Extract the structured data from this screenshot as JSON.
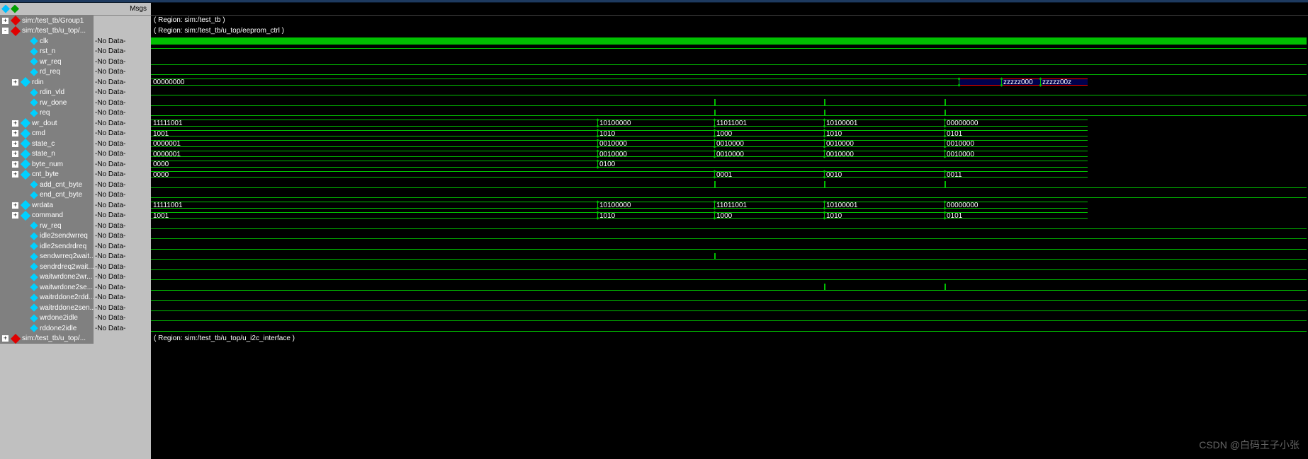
{
  "header": {
    "msgs_label": "Msgs"
  },
  "regions": {
    "r1": "( Region: sim:/test_tb )",
    "r2": "( Region: sim:/test_tb/u_top/eeprom_ctrl )",
    "r3": "( Region: sim:/test_tb/u_top/u_i2c_interface )"
  },
  "no_data": "-No Data-",
  "signals": [
    {
      "name": "sim:/test_tb/Group1",
      "type": "group",
      "exp": "+",
      "val": ""
    },
    {
      "name": "sim:/test_tb/u_top/...",
      "type": "group",
      "exp": "-",
      "val": ""
    },
    {
      "name": "clk",
      "type": "leaf",
      "indent": 3,
      "val": "-No Data-"
    },
    {
      "name": "rst_n",
      "type": "leaf",
      "indent": 3,
      "val": "-No Data-"
    },
    {
      "name": "wr_req",
      "type": "leaf",
      "indent": 3,
      "val": "-No Data-"
    },
    {
      "name": "rd_req",
      "type": "leaf",
      "indent": 3,
      "val": "-No Data-"
    },
    {
      "name": "rdin",
      "type": "bus",
      "exp": "+",
      "indent": 2,
      "val": "-No Data-"
    },
    {
      "name": "rdin_vld",
      "type": "leaf",
      "indent": 3,
      "val": "-No Data-"
    },
    {
      "name": "rw_done",
      "type": "leaf",
      "indent": 3,
      "val": "-No Data-"
    },
    {
      "name": "req",
      "type": "leaf",
      "indent": 3,
      "val": "-No Data-"
    },
    {
      "name": "wr_dout",
      "type": "bus",
      "exp": "+",
      "indent": 2,
      "val": "-No Data-"
    },
    {
      "name": "cmd",
      "type": "bus",
      "exp": "+",
      "indent": 2,
      "val": "-No Data-"
    },
    {
      "name": "state_c",
      "type": "bus",
      "exp": "+",
      "indent": 2,
      "val": "-No Data-"
    },
    {
      "name": "state_n",
      "type": "bus",
      "exp": "+",
      "indent": 2,
      "val": "-No Data-"
    },
    {
      "name": "byte_num",
      "type": "bus",
      "exp": "+",
      "indent": 2,
      "val": "-No Data-"
    },
    {
      "name": "cnt_byte",
      "type": "bus",
      "exp": "+",
      "indent": 2,
      "val": "-No Data-"
    },
    {
      "name": "add_cnt_byte",
      "type": "leaf",
      "indent": 3,
      "val": "-No Data-"
    },
    {
      "name": "end_cnt_byte",
      "type": "leaf",
      "indent": 3,
      "val": "-No Data-"
    },
    {
      "name": "wrdata",
      "type": "bus",
      "exp": "+",
      "indent": 2,
      "val": "-No Data-"
    },
    {
      "name": "command",
      "type": "bus",
      "exp": "+",
      "indent": 2,
      "val": "-No Data-"
    },
    {
      "name": "rw_req",
      "type": "leaf",
      "indent": 3,
      "val": "-No Data-"
    },
    {
      "name": "idle2sendwrreq",
      "type": "leaf",
      "indent": 3,
      "val": "-No Data-"
    },
    {
      "name": "idle2sendrdreq",
      "type": "leaf",
      "indent": 3,
      "val": "-No Data-"
    },
    {
      "name": "sendwrreq2wait...",
      "type": "leaf",
      "indent": 3,
      "val": "-No Data-"
    },
    {
      "name": "sendrdreq2wait...",
      "type": "leaf",
      "indent": 3,
      "val": "-No Data-"
    },
    {
      "name": "waitwrdone2wr...",
      "type": "leaf",
      "indent": 3,
      "val": "-No Data-"
    },
    {
      "name": "waitwrdone2se...",
      "type": "leaf",
      "indent": 3,
      "val": "-No Data-"
    },
    {
      "name": "waitrddone2rdd...",
      "type": "leaf",
      "indent": 3,
      "val": "-No Data-"
    },
    {
      "name": "waitrddone2sen...",
      "type": "leaf",
      "indent": 3,
      "val": "-No Data-"
    },
    {
      "name": "wrdone2idle",
      "type": "leaf",
      "indent": 3,
      "val": "-No Data-"
    },
    {
      "name": "rddone2idle",
      "type": "leaf",
      "indent": 3,
      "val": "-No Data-"
    },
    {
      "name": "sim:/test_tb/u_top/...",
      "type": "group",
      "exp": "+",
      "val": ""
    }
  ],
  "bus_data": {
    "rdin": {
      "segments": [
        {
          "start": 0,
          "end": 1140,
          "label": "00000000"
        },
        {
          "start": 1140,
          "end": 1200,
          "label": "",
          "z": true
        },
        {
          "start": 1200,
          "end": 1255,
          "label": "zzzzz000",
          "z": true
        },
        {
          "start": 1255,
          "end": 1322,
          "label": "zzzzz00z",
          "z": true
        }
      ]
    },
    "wr_dout": {
      "segments": [
        {
          "start": 0,
          "end": 630,
          "label": "11111001"
        },
        {
          "start": 630,
          "end": 795,
          "label": "10100000"
        },
        {
          "start": 795,
          "end": 950,
          "label": "11011001"
        },
        {
          "start": 950,
          "end": 1120,
          "label": "10100001"
        },
        {
          "start": 1120,
          "end": 1322,
          "label": "00000000"
        }
      ]
    },
    "cmd": {
      "segments": [
        {
          "start": 0,
          "end": 630,
          "label": "1001"
        },
        {
          "start": 630,
          "end": 795,
          "label": "1010"
        },
        {
          "start": 795,
          "end": 950,
          "label": "1000"
        },
        {
          "start": 950,
          "end": 1120,
          "label": "1010"
        },
        {
          "start": 1120,
          "end": 1322,
          "label": "0101"
        }
      ]
    },
    "state_c": {
      "segments": [
        {
          "start": 0,
          "end": 630,
          "label": "0000001"
        },
        {
          "start": 630,
          "end": 795,
          "label": "0010000"
        },
        {
          "start": 795,
          "end": 950,
          "label": "0010000"
        },
        {
          "start": 950,
          "end": 1120,
          "label": "0010000"
        },
        {
          "start": 1120,
          "end": 1322,
          "label": "0010000"
        }
      ]
    },
    "state_n": {
      "segments": [
        {
          "start": 0,
          "end": 630,
          "label": "0000001"
        },
        {
          "start": 630,
          "end": 795,
          "label": "0010000"
        },
        {
          "start": 795,
          "end": 950,
          "label": "0010000"
        },
        {
          "start": 950,
          "end": 1120,
          "label": "0010000"
        },
        {
          "start": 1120,
          "end": 1322,
          "label": "0010000"
        }
      ]
    },
    "byte_num": {
      "segments": [
        {
          "start": 0,
          "end": 630,
          "label": "0000"
        },
        {
          "start": 630,
          "end": 1322,
          "label": "0100"
        }
      ]
    },
    "cnt_byte": {
      "segments": [
        {
          "start": 0,
          "end": 795,
          "label": "0000"
        },
        {
          "start": 795,
          "end": 950,
          "label": "0001"
        },
        {
          "start": 950,
          "end": 1120,
          "label": "0010"
        },
        {
          "start": 1120,
          "end": 1322,
          "label": "0011"
        }
      ]
    },
    "wrdata": {
      "segments": [
        {
          "start": 0,
          "end": 630,
          "label": "11111001"
        },
        {
          "start": 630,
          "end": 795,
          "label": "10100000"
        },
        {
          "start": 795,
          "end": 950,
          "label": "11011001"
        },
        {
          "start": 950,
          "end": 1120,
          "label": "10100001"
        },
        {
          "start": 1120,
          "end": 1322,
          "label": "00000000"
        }
      ]
    },
    "command": {
      "segments": [
        {
          "start": 0,
          "end": 630,
          "label": "1001"
        },
        {
          "start": 630,
          "end": 795,
          "label": "1010"
        },
        {
          "start": 795,
          "end": 950,
          "label": "1000"
        },
        {
          "start": 950,
          "end": 1120,
          "label": "1010"
        },
        {
          "start": 1120,
          "end": 1322,
          "label": "0101"
        }
      ]
    }
  },
  "pulse_positions": [
    795,
    950,
    1120
  ],
  "watermark": "CSDN @白码王子小张"
}
